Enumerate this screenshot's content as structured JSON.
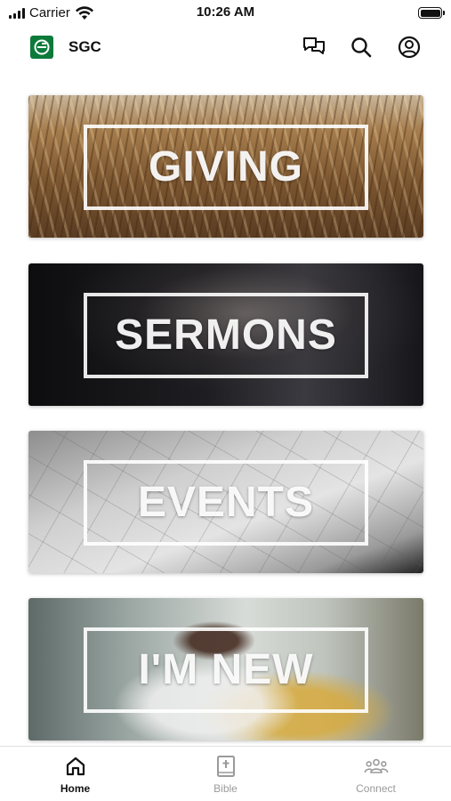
{
  "status_bar": {
    "carrier": "Carrier",
    "time": "10:26 AM"
  },
  "header": {
    "title": "SGC",
    "icons": [
      "chat-icon",
      "search-icon",
      "profile-icon"
    ]
  },
  "tiles": [
    {
      "label": "GIVING"
    },
    {
      "label": "SERMONS"
    },
    {
      "label": "EVENTS"
    },
    {
      "label": "I'M NEW"
    }
  ],
  "tab_bar": {
    "items": [
      {
        "label": "Home",
        "icon": "home-icon",
        "active": true
      },
      {
        "label": "Bible",
        "icon": "bible-icon",
        "active": false
      },
      {
        "label": "Connect",
        "icon": "people-icon",
        "active": false
      }
    ]
  },
  "colors": {
    "brand": "#0c7a3a",
    "active_tab": "#111111",
    "inactive_tab": "#9a9a9a"
  }
}
